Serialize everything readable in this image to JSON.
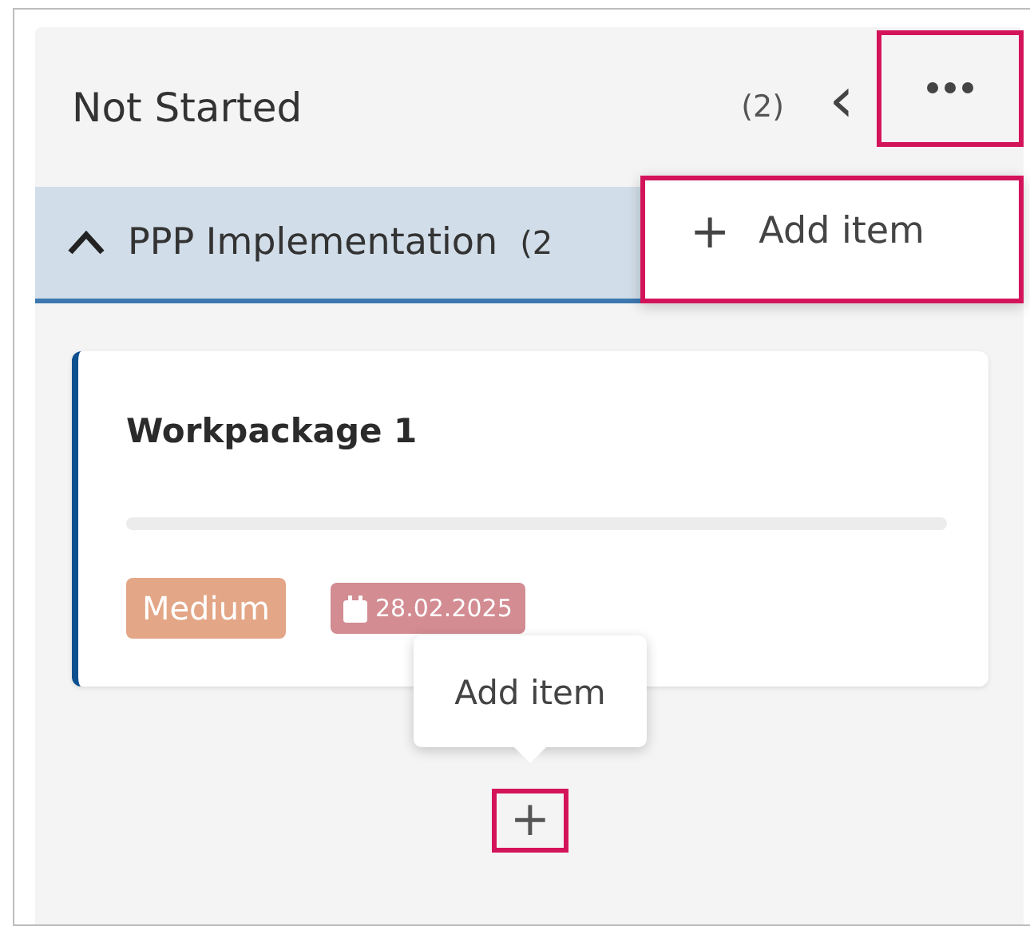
{
  "column": {
    "title": "Not Started",
    "count": "(2)",
    "collapse_icon": "‹",
    "more_highlighted": true
  },
  "menu": {
    "open": true,
    "items": [
      {
        "icon": "+",
        "label": "Add item",
        "highlighted": true
      }
    ]
  },
  "group": {
    "title": "PPP Implementation",
    "count": "(2",
    "expanded": true
  },
  "cards": [
    {
      "title": "Workpackage 1",
      "progress": {
        "level": 0
      },
      "priority": {
        "label": "Medium",
        "color": "#e3a686"
      },
      "due": {
        "label": "28.02.2025",
        "color": "#d28c92"
      }
    }
  ],
  "add_button": {
    "icon": "+",
    "highlighted": true,
    "tooltip": "Add item"
  }
}
